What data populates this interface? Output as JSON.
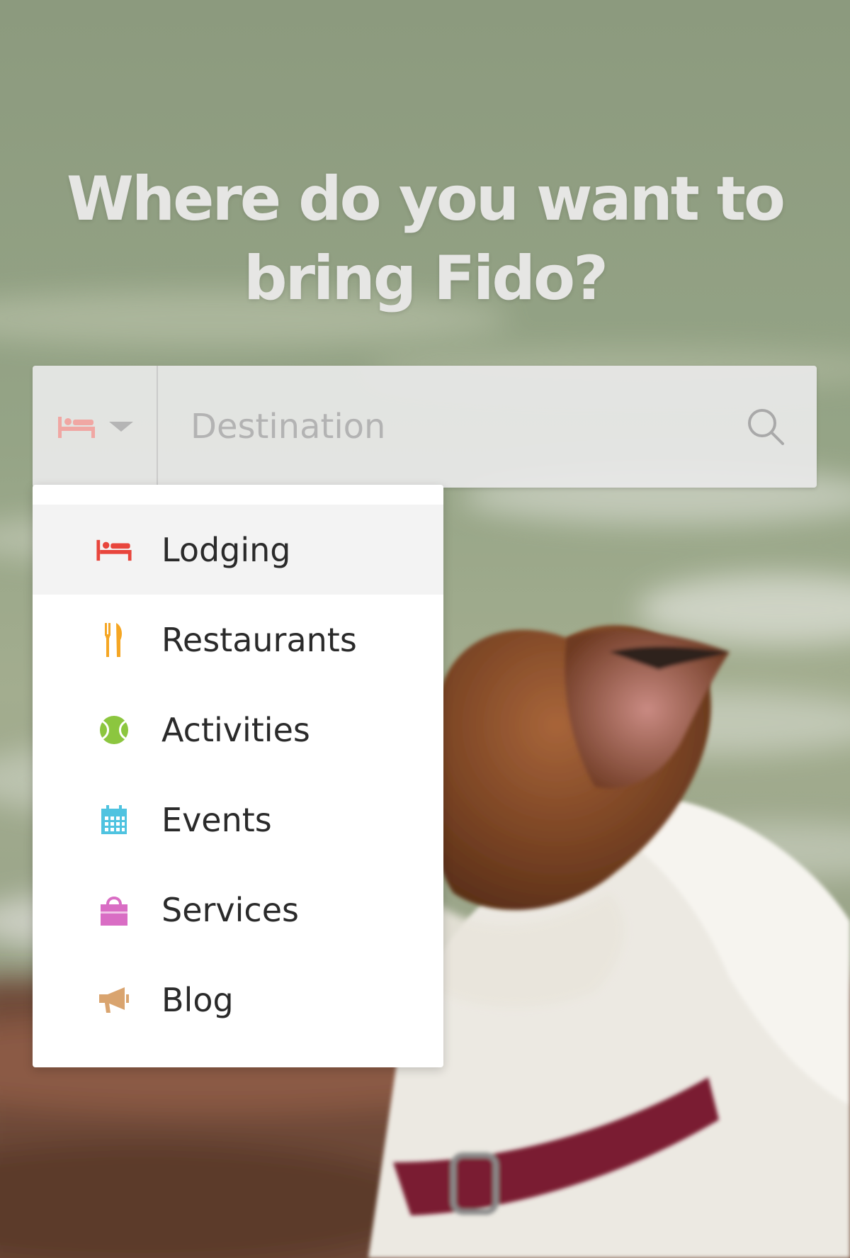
{
  "headline": {
    "line1": "Where do you want to",
    "line2": "bring Fido?"
  },
  "search": {
    "category_icon": "bed-icon",
    "placeholder": "Destination",
    "search_icon": "search-icon"
  },
  "dropdown": {
    "items": [
      {
        "label": "Lodging",
        "icon": "bed-icon",
        "color": "#e8453c",
        "selected": true
      },
      {
        "label": "Restaurants",
        "icon": "fork-knife-icon",
        "color": "#f5a623",
        "selected": false
      },
      {
        "label": "Activities",
        "icon": "tennis-ball-icon",
        "color": "#8cc63f",
        "selected": false
      },
      {
        "label": "Events",
        "icon": "calendar-icon",
        "color": "#4fc3e0",
        "selected": false
      },
      {
        "label": "Services",
        "icon": "shopping-bag-icon",
        "color": "#d96dc4",
        "selected": false
      },
      {
        "label": "Blog",
        "icon": "megaphone-icon",
        "color": "#d9a46f",
        "selected": false
      }
    ]
  },
  "colors": {
    "selected_row_bg": "#f3f3f3",
    "searchbar_bg": "#e8e8e8",
    "headline_text": "#e6e6e4"
  }
}
